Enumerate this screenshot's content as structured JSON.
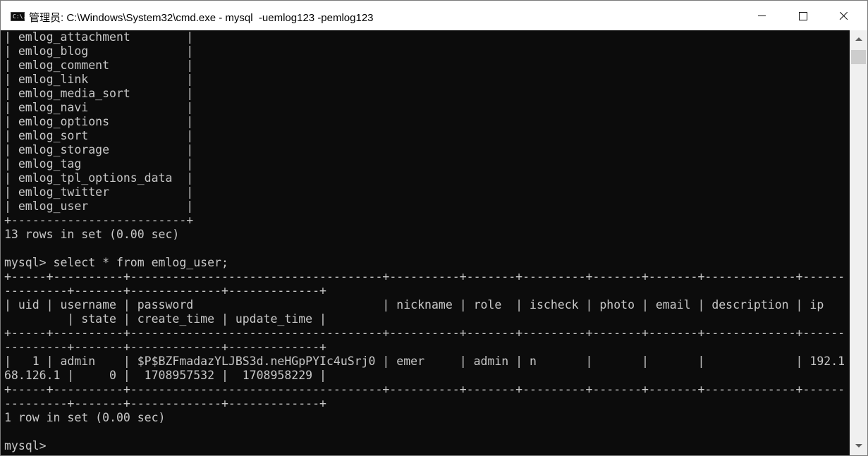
{
  "window": {
    "title": "管理员: C:\\Windows\\System32\\cmd.exe - mysql  -uemlog123 -pemlog123",
    "icon_text": "C:\\."
  },
  "console": {
    "lines": [
      "| emlog_attachment        |",
      "| emlog_blog              |",
      "| emlog_comment           |",
      "| emlog_link              |",
      "| emlog_media_sort        |",
      "| emlog_navi              |",
      "| emlog_options           |",
      "| emlog_sort              |",
      "| emlog_storage           |",
      "| emlog_tag               |",
      "| emlog_tpl_options_data  |",
      "| emlog_twitter           |",
      "| emlog_user              |",
      "+-------------------------+",
      "13 rows in set (0.00 sec)",
      "",
      "mysql> select * from emlog_user;",
      "+-----+----------+------------------------------------+----------+-------+---------+-------+-------+-------------+------",
      "---------+-------+-------------+-------------+",
      "| uid | username | password                           | nickname | role  | ischeck | photo | email | description | ip",
      "         | state | create_time | update_time |",
      "+-----+----------+------------------------------------+----------+-------+---------+-------+-------+-------------+------",
      "---------+-------+-------------+-------------+",
      "|   1 | admin    | $P$BZFmadazYLJBS3d.neHGpPYIc4uSrj0 | emer     | admin | n       |       |       |             | 192.1",
      "68.126.1 |     0 |  1708957532 |  1708958229 |",
      "+-----+----------+------------------------------------+----------+-------+---------+-------+-------+-------------+------",
      "---------+-------+-------------+-------------+",
      "1 row in set (0.00 sec)",
      "",
      "mysql>"
    ]
  }
}
